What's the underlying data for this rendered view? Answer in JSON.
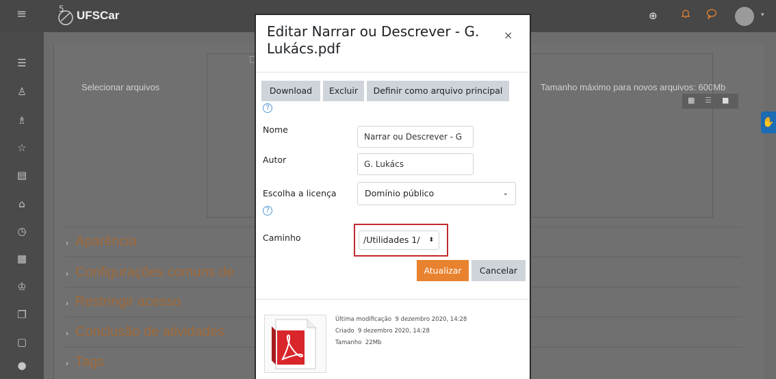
{
  "header": {
    "logo_text": "UFSCar",
    "icons": [
      "menu-icon",
      "globe-icon",
      "bell-icon",
      "chat-icon",
      "avatar",
      "caret-down-icon"
    ]
  },
  "sidebar": {
    "icons": [
      "list-icon",
      "teacher-icon",
      "users-icon",
      "star-icon",
      "book-icon",
      "home-icon",
      "dashboard-icon",
      "calendar-icon",
      "graduation-icon",
      "copy-icon",
      "clipboard-icon",
      "accessibility-icon"
    ]
  },
  "background": {
    "select_files_label": "Selecionar arquivos",
    "max_size_label": "Tamanho máximo para novos arquivos: 600Mb",
    "sections": [
      "Aparência",
      "Configurações comuns de",
      "Restringir acesso",
      "Conclusão de atividades",
      "Tags"
    ]
  },
  "modal": {
    "title": "Editar Narrar ou Descrever - G. Lukács.pdf",
    "close_symbol": "×",
    "buttons": {
      "download": "Download",
      "delete": "Excluir",
      "set_main": "Definir como arquivo principal"
    },
    "fields": {
      "name_label": "Nome",
      "name_value": "Narrar ou Descrever - G",
      "author_label": "Autor",
      "author_value": "G. Lukács",
      "license_label": "Escolha a licença",
      "license_value": "Domínio público",
      "path_label": "Caminho",
      "path_value": "/Utilidades 1/"
    },
    "update_label": "Atualizar",
    "cancel_label": "Cancelar",
    "file_info": {
      "modified_label": "Última modificação",
      "modified_value": "9 dezembro 2020, 14:28",
      "created_label": "Criado",
      "created_value": "9 dezembro 2020, 14:28",
      "size_label": "Tamanho",
      "size_value": "22Mb"
    }
  },
  "colors": {
    "primary": "#e8822e",
    "highlight_border": "#c0282e",
    "navbar": "#474747"
  }
}
